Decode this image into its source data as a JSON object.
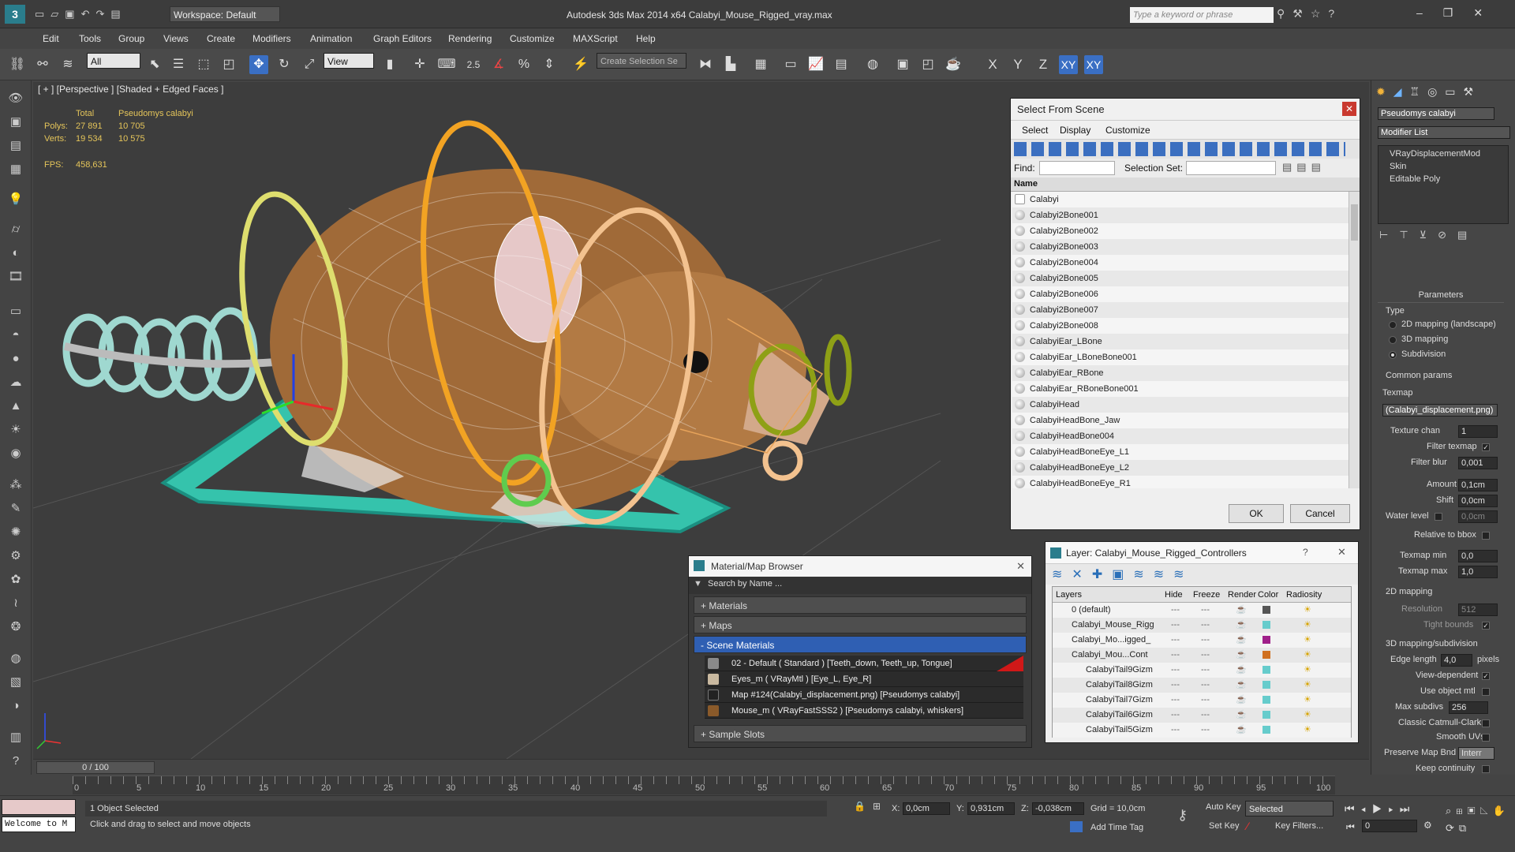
{
  "app": {
    "title": "Autodesk 3ds Max  2014 x64    Calabyi_Mouse_Rigged_vray.max",
    "workspace": "Workspace: Default",
    "search_placeholder": "Type a keyword or phrase"
  },
  "menu": [
    "Edit",
    "Tools",
    "Group",
    "Views",
    "Create",
    "Modifiers",
    "Animation",
    "Graph Editors",
    "Rendering",
    "Customize",
    "MAXScript",
    "Help"
  ],
  "toolbar": {
    "filter": "All",
    "coord": "View",
    "snap_label": "2.5",
    "selection_set_placeholder": "Create Selection Se",
    "axes": [
      "X",
      "Y",
      "Z",
      "XY",
      "XY"
    ]
  },
  "viewport": {
    "label": "[ + ] [Perspective ] [Shaded + Edged Faces ]",
    "stats": {
      "total_label": "Total",
      "object_name": "Pseudomys calabyi",
      "polys_label": "Polys:",
      "polys_total": "27 891",
      "polys_obj": "10 705",
      "verts_label": "Verts:",
      "verts_total": "19 534",
      "verts_obj": "10 575",
      "fps_label": "FPS:",
      "fps_value": "458,631"
    }
  },
  "select_from_scene": {
    "title": "Select From Scene",
    "menu": [
      "Select",
      "Display",
      "Customize"
    ],
    "find_label": "Find:",
    "selection_set_label": "Selection Set:",
    "column_name": "Name",
    "items": [
      "Calabyi",
      "Calabyi2Bone001",
      "Calabyi2Bone002",
      "Calabyi2Bone003",
      "Calabyi2Bone004",
      "Calabyi2Bone005",
      "Calabyi2Bone006",
      "Calabyi2Bone007",
      "Calabyi2Bone008",
      "CalabyiEar_LBone",
      "CalabyiEar_LBoneBone001",
      "CalabyiEar_RBone",
      "CalabyiEar_RBoneBone001",
      "CalabyiHead",
      "CalabyiHeadBone_Jaw",
      "CalabyiHeadBone004",
      "CalabyiHeadBoneEye_L1",
      "CalabyiHeadBoneEye_L2",
      "CalabyiHeadBoneEye_R1"
    ],
    "ok": "OK",
    "cancel": "Cancel"
  },
  "material_browser": {
    "title": "Material/Map Browser",
    "search_placeholder": "Search by Name ...",
    "rollouts": [
      "+ Materials",
      "+ Maps",
      "- Scene Materials",
      "+ Sample Slots"
    ],
    "scene_materials": [
      {
        "text": "02 - Default  ( Standard ) [Teeth_down, Teeth_up, Tongue]",
        "color": "#8a8a8a"
      },
      {
        "text": "Eyes_m  ( VRayMtl ) [Eye_L, Eye_R]",
        "color": "#c9b9a0"
      },
      {
        "text": "Map #124(Calabyi_displacement.png) [Pseudomys calabyi]",
        "color": "#222222"
      },
      {
        "text": "Mouse_m  ( VRayFastSSS2 ) [Pseudomys calabyi, whiskers]",
        "color": "#8a5a2a"
      }
    ]
  },
  "layer_dialog": {
    "title": "Layer: Calabyi_Mouse_Rigged_Controllers",
    "help": "?",
    "columns": [
      "Layers",
      "Hide",
      "Freeze",
      "Render",
      "Color",
      "Radiosity"
    ],
    "rows": [
      {
        "name": "0 (default)",
        "color": "#555555",
        "indent": 0
      },
      {
        "name": "Calabyi_Mouse_Rigg",
        "color": "#66cccc",
        "indent": 0
      },
      {
        "name": "Calabyi_Mo...igged_",
        "color": "#a0208a",
        "indent": 0
      },
      {
        "name": "Calabyi_Mou...Cont",
        "color": "#d07020",
        "indent": 0
      },
      {
        "name": "CalabyiTail9Gizm",
        "color": "#66cccc",
        "indent": 1
      },
      {
        "name": "CalabyiTail8Gizm",
        "color": "#66cccc",
        "indent": 1
      },
      {
        "name": "CalabyiTail7Gizm",
        "color": "#66cccc",
        "indent": 1
      },
      {
        "name": "CalabyiTail6Gizm",
        "color": "#66cccc",
        "indent": 1
      },
      {
        "name": "CalabyiTail5Gizm",
        "color": "#66cccc",
        "indent": 1
      }
    ]
  },
  "command_panel": {
    "object_name": "Pseudomys calabyi",
    "modifier_list": "Modifier List",
    "stack": [
      "VRayDisplacementMod",
      "Skin",
      "Editable Poly"
    ],
    "parameters": "Parameters",
    "type_label": "Type",
    "types": [
      "2D mapping (landscape)",
      "3D mapping",
      "Subdivision"
    ],
    "common_params": "Common params",
    "texmap_label": "Texmap",
    "texmap_value": "(Calabyi_displacement.png)",
    "texture_chan_label": "Texture chan",
    "texture_chan": "1",
    "filter_texmap": "Filter texmap",
    "filter_blur_label": "Filter blur",
    "filter_blur": "0,001",
    "amount_label": "Amount",
    "amount": "0,1cm",
    "shift_label": "Shift",
    "shift": "0,0cm",
    "water_label": "Water level",
    "water": "0,0cm",
    "relative_bbox": "Relative to bbox",
    "texmap_min_label": "Texmap min",
    "texmap_min": "0,0",
    "texmap_max_label": "Texmap max",
    "texmap_max": "1,0",
    "mapping2d": "2D mapping",
    "resolution_label": "Resolution",
    "resolution": "512",
    "tight_bounds": "Tight bounds",
    "mapping3d": "3D mapping/subdivision",
    "edge_length_label": "Edge length",
    "edge_length": "4,0",
    "pixels": "pixels",
    "view_dependent": "View-dependent",
    "use_object_mtl": "Use object mtl",
    "max_subdivs_label": "Max subdivs",
    "max_subdivs": "256",
    "classic_cc": "Classic Catmull-Clark",
    "smooth_uvs": "Smooth UVs",
    "preserve_map_bnd": "Preserve Map Bnd",
    "preserve_value": "Interr",
    "keep_continuity": "Keep continuity"
  },
  "timeline": {
    "frame": "0 / 100",
    "ticks": [
      "0",
      "5",
      "10",
      "15",
      "20",
      "25",
      "30",
      "35",
      "40",
      "45",
      "50",
      "55",
      "60",
      "65",
      "70",
      "75",
      "80",
      "85",
      "90",
      "95",
      "100"
    ]
  },
  "status": {
    "maxscript": "Welcome to M",
    "selected": "1 Object Selected",
    "prompt": "Click and drag to select and move objects",
    "x_label": "X:",
    "x": "0,0cm",
    "y_label": "Y:",
    "y": "0,931cm",
    "z_label": "Z:",
    "z": "-0,038cm",
    "grid": "Grid = 10,0cm",
    "auto_key": "Auto Key",
    "set_key": "Set Key",
    "selected_dd": "Selected",
    "key_filters": "Key Filters...",
    "add_time_tag": "Add Time Tag",
    "frame_field": "0"
  }
}
